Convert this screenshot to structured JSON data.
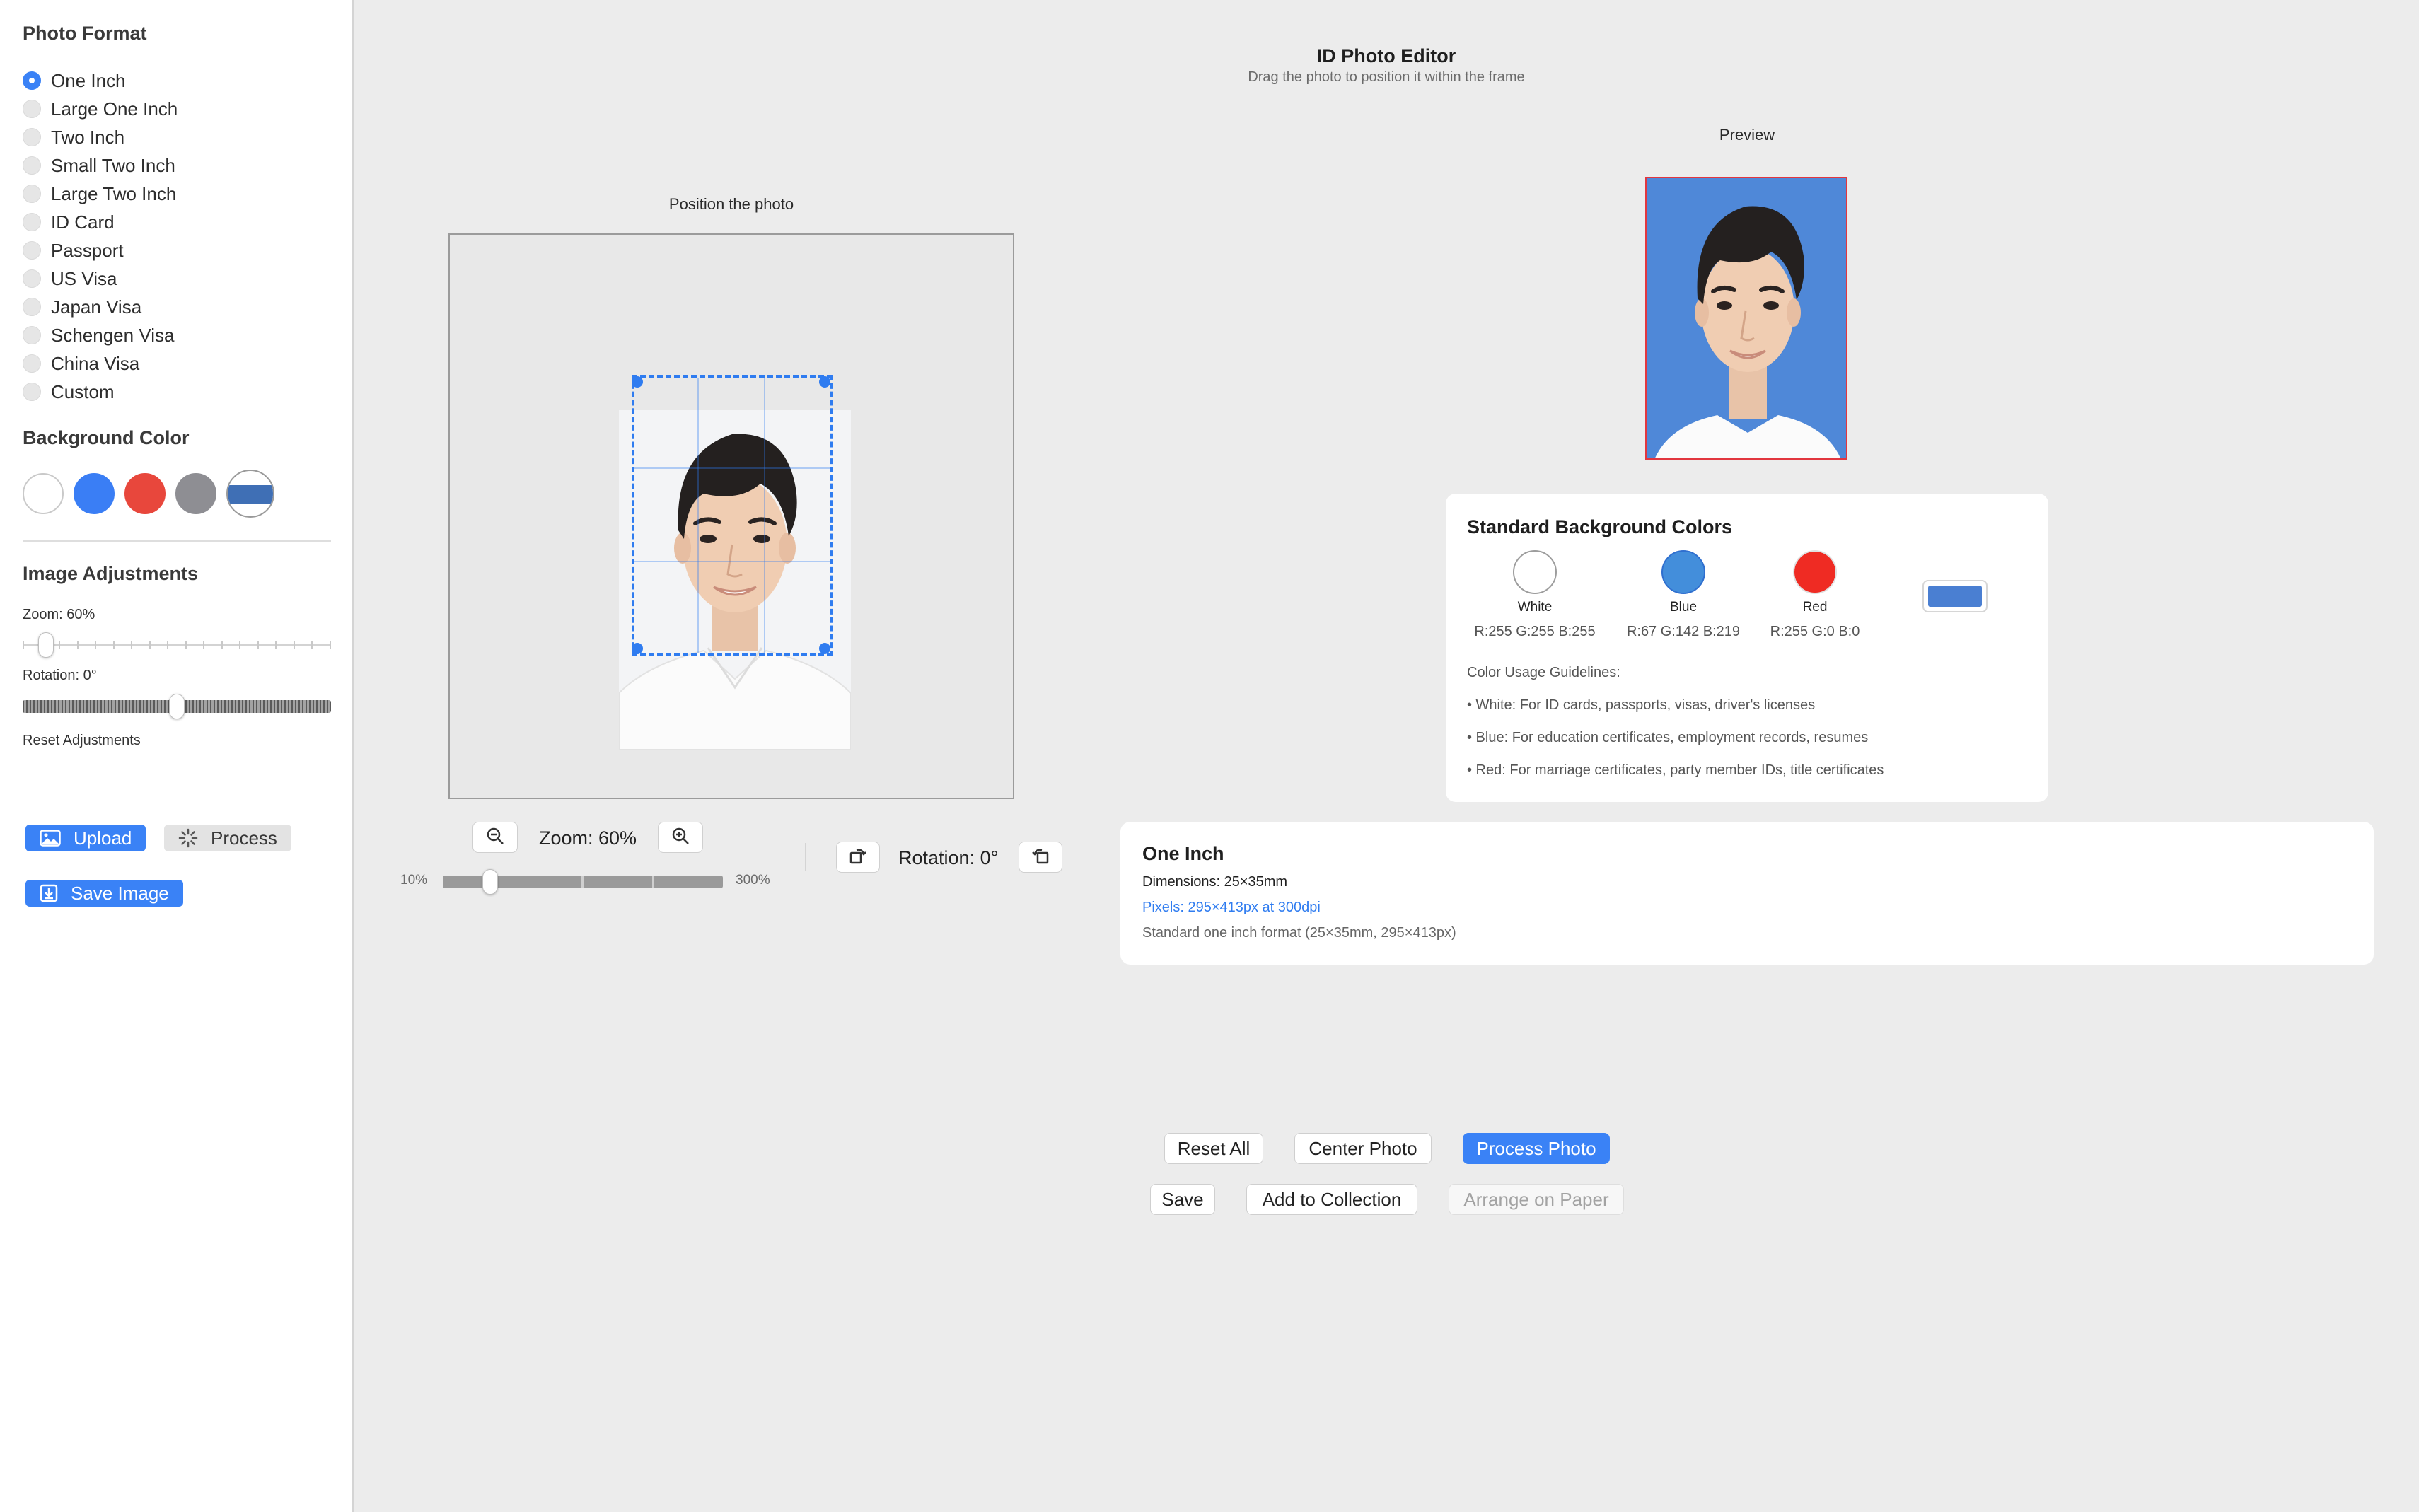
{
  "sidebar": {
    "format_title": "Photo Format",
    "formats": [
      {
        "label": "One Inch",
        "selected": true
      },
      {
        "label": "Large One Inch",
        "selected": false
      },
      {
        "label": "Two Inch",
        "selected": false
      },
      {
        "label": "Small Two Inch",
        "selected": false
      },
      {
        "label": "Large Two Inch",
        "selected": false
      },
      {
        "label": "ID Card",
        "selected": false
      },
      {
        "label": "Passport",
        "selected": false
      },
      {
        "label": "US Visa",
        "selected": false
      },
      {
        "label": "Japan Visa",
        "selected": false
      },
      {
        "label": "Schengen Visa",
        "selected": false
      },
      {
        "label": "China Visa",
        "selected": false
      },
      {
        "label": "Custom",
        "selected": false
      }
    ],
    "background_title": "Background Color",
    "background_swatches": [
      "#ffffff",
      "#3a7ef5",
      "#e8473c",
      "#8e8e93",
      "#3f6fb5"
    ],
    "adjust_title": "Image Adjustments",
    "zoom_label": "Zoom: 60%",
    "zoom_fraction": 0.05,
    "rotation_label": "Rotation: 0°",
    "rotation_fraction": 0.5,
    "reset_label": "Reset Adjustments",
    "upload_label": "Upload",
    "process_label": "Process",
    "save_image_label": "Save Image"
  },
  "header": {
    "title": "ID Photo Editor",
    "subtitle": "Drag the photo to position it within the frame"
  },
  "editor": {
    "canvas_label": "Position the photo",
    "zoom_text": "Zoom: 60%",
    "zoom_min": "10%",
    "zoom_max": "300%",
    "zoom_fraction": 0.17,
    "rotation_text": "Rotation: 0°"
  },
  "preview": {
    "label": "Preview",
    "background": "#4f88d8"
  },
  "standard_colors": {
    "title": "Standard Background Colors",
    "colors": [
      {
        "name": "White",
        "rgb": "R:255 G:255 B:255",
        "hex": "#ffffff"
      },
      {
        "name": "Blue",
        "rgb": "R:67 G:142 B:219",
        "hex": "#438edb"
      },
      {
        "name": "Red",
        "rgb": "R:255 G:0 B:0",
        "hex": "#ef2b23"
      }
    ],
    "guidelines_title": "Color Usage Guidelines:",
    "guidelines": [
      "• White: For ID cards, passports, visas, driver's licenses",
      "• Blue: For education certificates, employment records, resumes",
      "• Red: For marriage certificates, party member IDs, title certificates"
    ]
  },
  "format_info": {
    "title": "One Inch",
    "dimensions": "Dimensions: 25×35mm",
    "pixels": "Pixels: 295×413px at 300dpi",
    "description": "Standard one inch format (25×35mm, 295×413px)"
  },
  "actions": {
    "reset_all": "Reset All",
    "center_photo": "Center Photo",
    "process_photo": "Process Photo",
    "save": "Save",
    "add_to_collection": "Add to Collection",
    "arrange_on_paper": "Arrange on Paper"
  },
  "colors": {
    "accent": "#3a82f6",
    "crop_border": "#2f7cf0",
    "preview_border": "#e2363f"
  }
}
